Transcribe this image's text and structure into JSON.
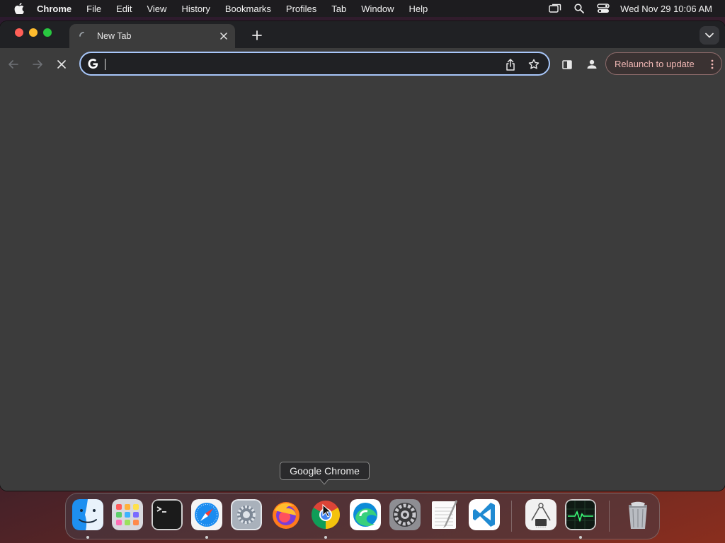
{
  "menubar": {
    "app_name": "Chrome",
    "items": [
      "File",
      "Edit",
      "View",
      "History",
      "Bookmarks",
      "Profiles",
      "Tab",
      "Window",
      "Help"
    ],
    "clock": "Wed Nov 29  10:06 AM",
    "tray_icons": [
      "screen-mirroring-icon",
      "spotlight-search-icon",
      "control-center-icon"
    ]
  },
  "browser": {
    "tab": {
      "title": "New Tab",
      "loading": true
    },
    "omnibox": {
      "value": "",
      "placeholder": ""
    },
    "relaunch_label": "Relaunch to update",
    "colors": {
      "omnibox_focus": "#a8c7fa",
      "relaunch_text": "#f2b8b5",
      "window_bg": "#3c3c3c",
      "tabstrip_bg": "#202124"
    }
  },
  "tooltip": {
    "text": "Google Chrome"
  },
  "dock": {
    "apps": [
      {
        "name": "Finder",
        "icon": "finder-icon",
        "running": true
      },
      {
        "name": "Launchpad",
        "icon": "launchpad-icon",
        "running": false
      },
      {
        "name": "Terminal",
        "icon": "terminal-icon",
        "running": false
      },
      {
        "name": "Safari",
        "icon": "safari-icon",
        "running": true
      },
      {
        "name": "System Preferences",
        "icon": "system-preferences-icon",
        "running": false
      },
      {
        "name": "Firefox",
        "icon": "firefox-icon",
        "running": false
      },
      {
        "name": "Google Chrome",
        "icon": "chrome-icon",
        "running": true
      },
      {
        "name": "Microsoft Edge",
        "icon": "edge-icon",
        "running": false
      },
      {
        "name": "System Settings",
        "icon": "system-settings-icon",
        "running": false
      },
      {
        "name": "TextEdit",
        "icon": "textedit-icon",
        "running": false
      },
      {
        "name": "Visual Studio Code",
        "icon": "vscode-icon",
        "running": false
      },
      {
        "name": "System Information",
        "icon": "system-information-icon",
        "running": false
      },
      {
        "name": "Activity Monitor",
        "icon": "activity-monitor-icon",
        "running": true
      },
      {
        "name": "Trash",
        "icon": "trash-icon",
        "running": false
      }
    ]
  }
}
